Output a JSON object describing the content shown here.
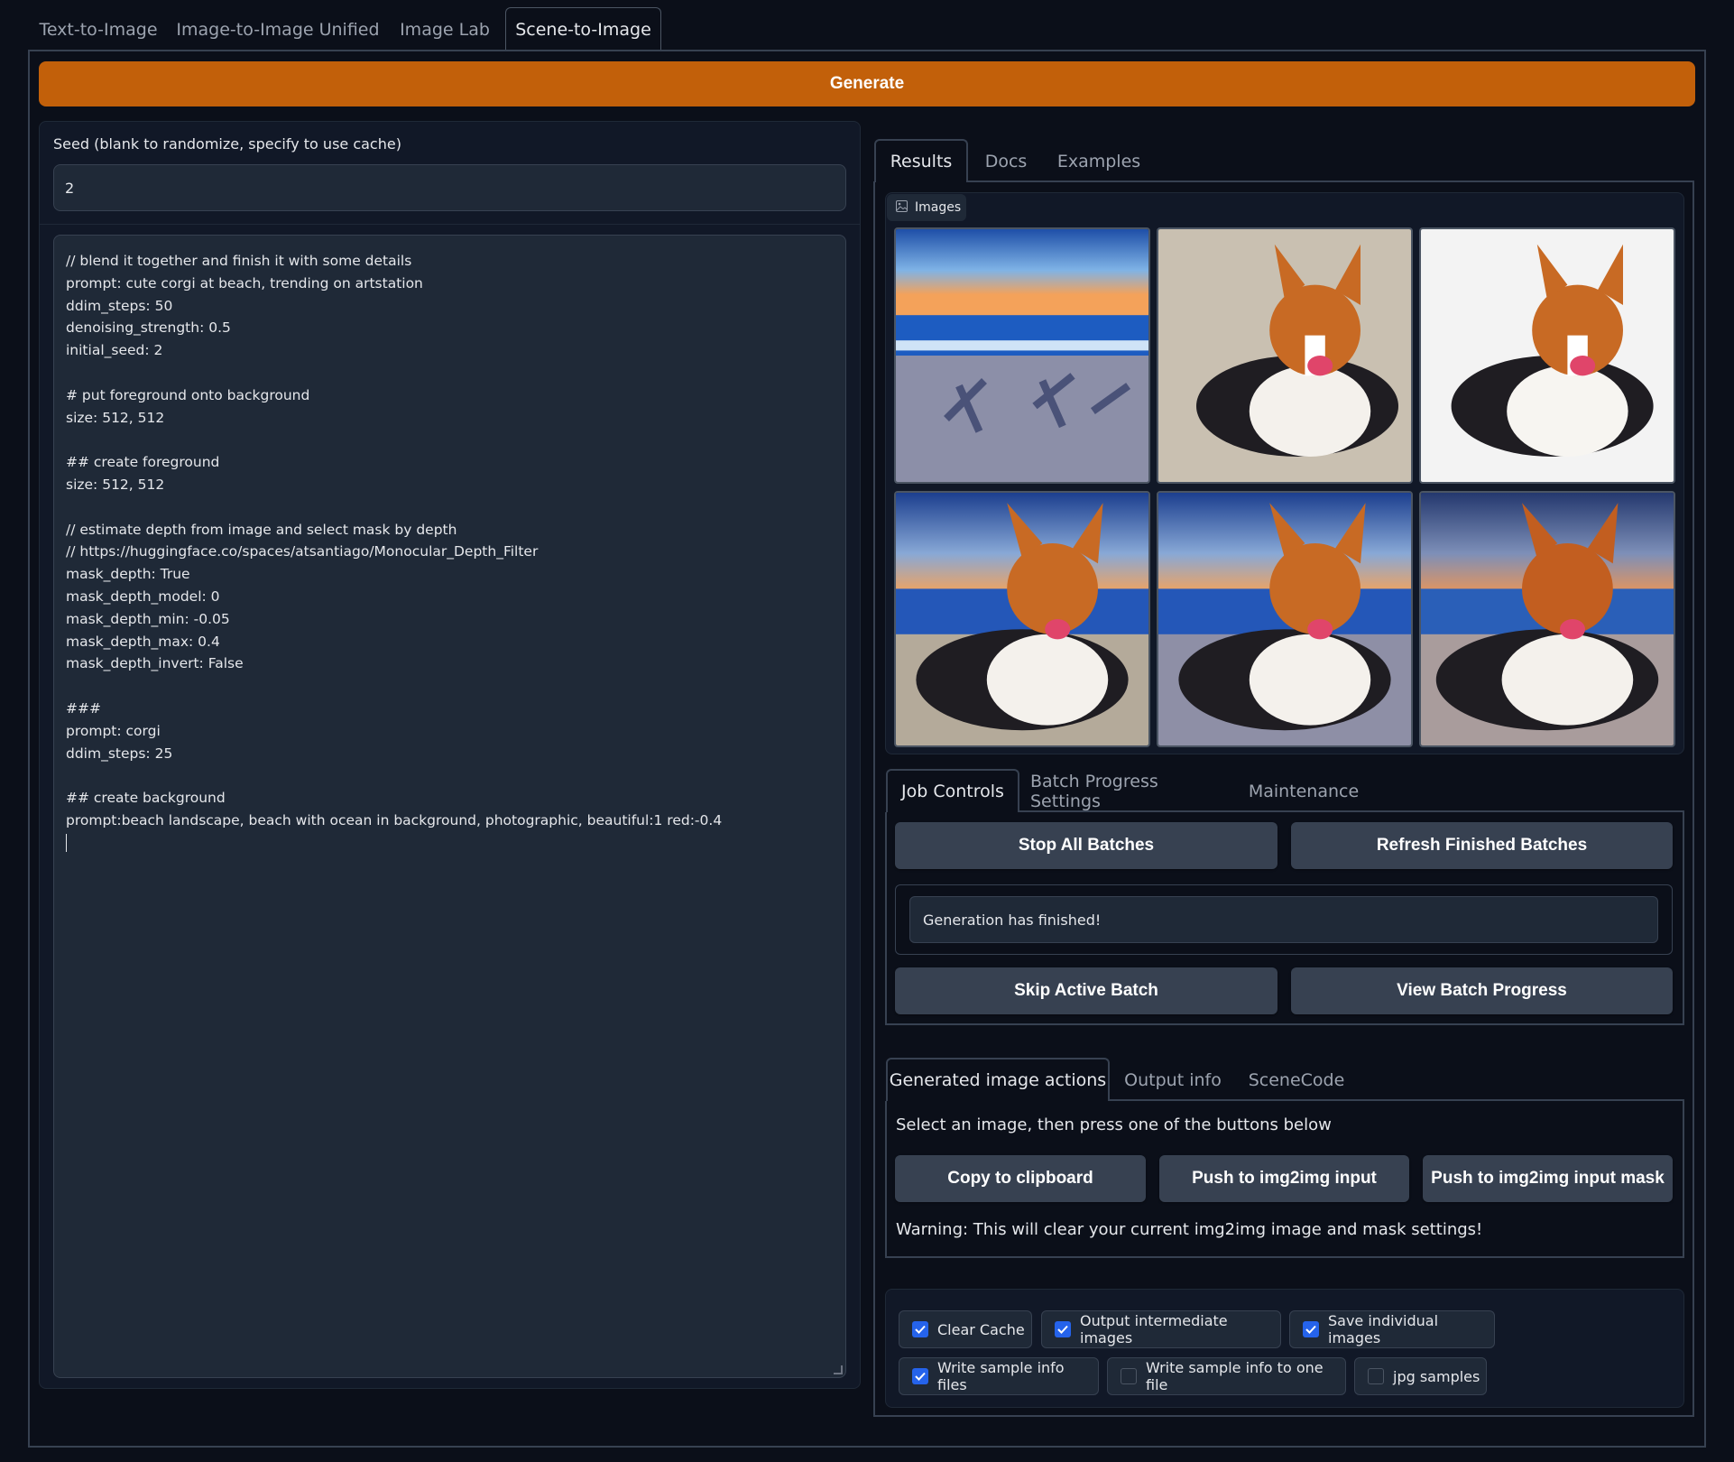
{
  "top_tabs": [
    "Text-to-Image",
    "Image-to-Image Unified",
    "Image Lab",
    "Scene-to-Image"
  ],
  "generate_label": "Generate",
  "seed": {
    "label": "Seed (blank to randomize, specify to use cache)",
    "value": "2"
  },
  "scene_code": "// blend it together and finish it with some details\nprompt: cute corgi at beach, trending on artstation\nddim_steps: 50\ndenoising_strength: 0.5\ninitial_seed: 2\n\n# put foreground onto background\nsize: 512, 512\n\n## create foreground\nsize: 512, 512\n\n// estimate depth from image and select mask by depth\n// https://huggingface.co/spaces/atsantiago/Monocular_Depth_Filter\nmask_depth: True\nmask_depth_model: 0\nmask_depth_min: -0.05\nmask_depth_max: 0.4\nmask_depth_invert: False\n\n###\nprompt: corgi\nddim_steps: 25\n\n## create background\nprompt:beach landscape, beach with ocean in background, photographic, beautiful:1 red:-0.4\n",
  "result_tabs": [
    "Results",
    "Docs",
    "Examples"
  ],
  "gallery": {
    "label": "Images",
    "images": [
      "beach-sunset",
      "corgi-on-sand",
      "corgi-white-background",
      "corgi-at-beach-1",
      "corgi-at-beach-2",
      "corgi-at-beach-3"
    ]
  },
  "job_tabs": [
    "Job Controls",
    "Batch Progress Settings",
    "Maintenance"
  ],
  "job_controls": {
    "stop_all": "Stop All Batches",
    "refresh": "Refresh Finished Batches",
    "status": "Generation has finished!",
    "skip": "Skip Active Batch",
    "view_progress": "View Batch Progress"
  },
  "action_tabs": [
    "Generated image actions",
    "Output info",
    "SceneCode"
  ],
  "actions": {
    "hint": "Select an image, then press one of the buttons below",
    "copy": "Copy to clipboard",
    "push_input": "Push to img2img input",
    "push_mask": "Push to img2img input mask",
    "warning": "Warning: This will clear your current img2img image and mask settings!"
  },
  "options": [
    {
      "label": "Clear Cache",
      "checked": true
    },
    {
      "label": "Output intermediate images",
      "checked": true
    },
    {
      "label": "Save individual images",
      "checked": true
    },
    {
      "label": "Write sample info files",
      "checked": true
    },
    {
      "label": "Write sample info to one file",
      "checked": false
    },
    {
      "label": "jpg samples",
      "checked": false
    }
  ],
  "colors": {
    "background": "#0b0f19",
    "panel": "#111827",
    "accent": "#c2600a",
    "checkbox": "#2563eb"
  }
}
